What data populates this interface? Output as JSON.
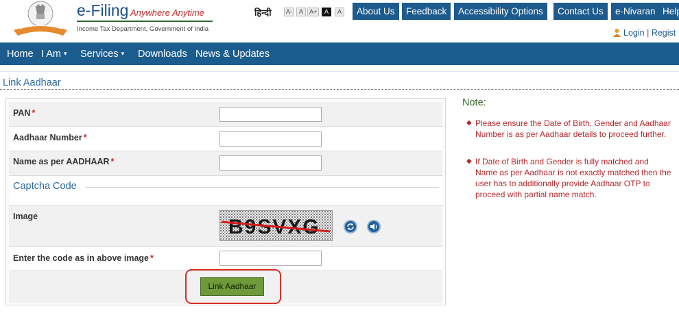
{
  "header": {
    "brand_title": "e-Filing",
    "brand_tagline": "Anywhere Anytime",
    "brand_sub": "Income Tax Department, Government of India",
    "hindi_label": "हिन्दी",
    "font_sizes": [
      "A-",
      "A",
      "A+",
      "A",
      "A"
    ],
    "nav": [
      "About Us",
      "Feedback",
      "Accessibility Options",
      "Contact Us",
      "e-Nivaran",
      "Help"
    ],
    "login": "Login",
    "register": "Regist"
  },
  "main_nav": {
    "items": [
      {
        "label": "Home",
        "dropdown": false
      },
      {
        "label": "I Am",
        "dropdown": true
      },
      {
        "label": "Services",
        "dropdown": true
      },
      {
        "label": "Downloads",
        "dropdown": false
      },
      {
        "label": "News & Updates",
        "dropdown": false
      }
    ]
  },
  "page_title": "Link Aadhaar",
  "form": {
    "pan_label": "PAN",
    "pan_value": "",
    "aadhaar_label": "Aadhaar Number",
    "aadhaar_value": "",
    "name_label": "Name as per AADHAAR",
    "name_value": "",
    "captcha_legend": "Captcha Code",
    "image_label": "Image",
    "captcha_text": "B9SVXG",
    "code_label": "Enter the code as in above image",
    "code_value": "",
    "required_mark": "*",
    "submit_label": "Link Aadhaar"
  },
  "note": {
    "title": "Note:",
    "items": [
      "Please ensure the Date of Birth, Gender and Aadhaar Number is as per Aadhaar details to proceed further.",
      "If Date of Birth and Gender is fully matched and Name as per Aadhaar is not exactly matched then the user has to additionally provide Aadhaar OTP to proceed with partial name match."
    ]
  },
  "colors": {
    "nav_blue": "#1b5c8f",
    "accent_red": "#c8282a",
    "button_green": "#6f9a3a",
    "highlight_red": "#d92d25"
  }
}
